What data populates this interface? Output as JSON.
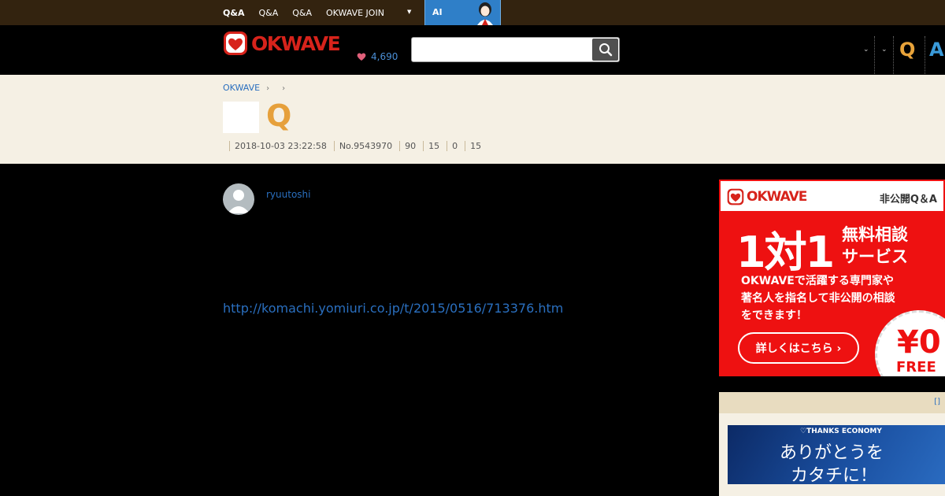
{
  "topbar": {
    "nav": [
      "Q&A",
      "Q&A",
      "Q&A",
      "OKWAVE JOIN"
    ],
    "ai_label": "AI"
  },
  "header": {
    "logo_text": "OKWAVE",
    "points": "4,690",
    "search_placeholder": "",
    "q_label": "Q",
    "a_label": "A"
  },
  "breadcrumb": {
    "home": "OKWAVE",
    "sep1": "›",
    "sep2": "›"
  },
  "question": {
    "mark": "Q",
    "datetime": "2018-10-03 23:22:58",
    "number": "No.9543970",
    "stats": [
      "90",
      "15",
      "0",
      "15"
    ],
    "username": "ryuutoshi",
    "link": "http://komachi.yomiuri.co.jp/t/2015/0516/713376.htm"
  },
  "ad": {
    "logo_text": "OKWAVE",
    "private_label": "非公開Q＆A",
    "big": "1対1",
    "sub_line1": "無料相談",
    "sub_line2": "サービス",
    "desc_line1": "OKWAVEで活躍する専門家や",
    "desc_line2": "著名人を指名して非公開の相談",
    "desc_line3": "をできます！",
    "more_label": "詳しくはこちら ›",
    "price": "¥0",
    "free": "FREE"
  },
  "sidebox": {
    "link": "[]",
    "banner_tag": "♡THANKS ECONOMY",
    "banner_line1": "ありがとうを",
    "banner_line2": "カタチに！"
  },
  "colors": {
    "topbar": "#33230f",
    "brand_red": "#d7231b",
    "link_blue": "#2a6fbf",
    "q_orange": "#e6a03b",
    "band": "#f5f0e4"
  }
}
